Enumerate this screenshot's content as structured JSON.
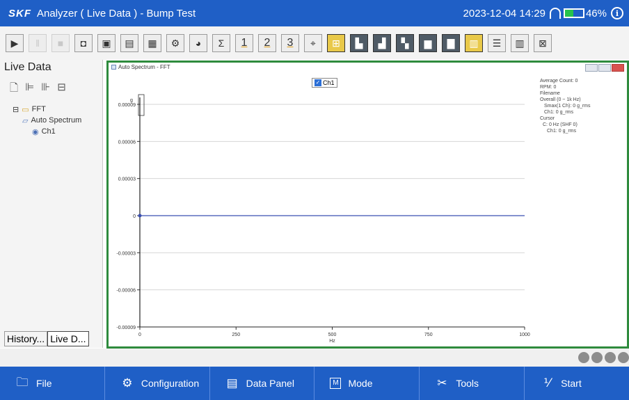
{
  "app": {
    "brand": "SKF",
    "title": "Analyzer ( Live Data ) - Bump Test",
    "datetime": "2023-12-04 14:29",
    "battery_text": "46%",
    "battery_level": 0.46,
    "colors": {
      "primary": "#1f5fc6",
      "accent_green": "#2e8b3d",
      "plot_line": "#3b4fb0"
    }
  },
  "toolbar": {
    "buttons": [
      {
        "icon": "play-icon",
        "glyph": "▶"
      },
      {
        "icon": "pause-icon",
        "glyph": "‖"
      },
      {
        "icon": "stop-icon",
        "glyph": "■"
      },
      {
        "icon": "camera-icon",
        "glyph": "◘"
      },
      {
        "icon": "image-icon",
        "glyph": "▣"
      },
      {
        "icon": "save-icon",
        "glyph": "▤"
      },
      {
        "icon": "report-icon",
        "glyph": "▦"
      },
      {
        "icon": "gear-icon",
        "glyph": "⚙"
      },
      {
        "icon": "pie-chart-icon",
        "glyph": "◕"
      },
      {
        "icon": "sum-icon",
        "glyph": "Σ"
      },
      {
        "icon": "view-1-icon",
        "glyph": "1"
      },
      {
        "icon": "view-2-icon",
        "glyph": "2"
      },
      {
        "icon": "view-3-icon",
        "glyph": "3"
      },
      {
        "icon": "cursor-icon",
        "glyph": "⌖"
      },
      {
        "icon": "add-icon",
        "glyph": "⊞"
      },
      {
        "icon": "spectrum-icon",
        "glyph": "▙"
      },
      {
        "icon": "spectrum-2-icon",
        "glyph": "▟"
      },
      {
        "icon": "waterfall-icon",
        "glyph": "▚"
      },
      {
        "icon": "bars-icon",
        "glyph": "▆"
      },
      {
        "icon": "histogram-icon",
        "glyph": "▇"
      },
      {
        "icon": "highlight-icon",
        "glyph": "▥"
      },
      {
        "icon": "rows-icon",
        "glyph": "☰"
      },
      {
        "icon": "columns-icon",
        "glyph": "▥"
      },
      {
        "icon": "close-window-icon",
        "glyph": "⊠"
      }
    ]
  },
  "left_panel": {
    "title": "Live Data",
    "tree": {
      "root": "FFT",
      "child": "Auto Spectrum",
      "leaf": "Ch1"
    },
    "tabs": [
      "History...",
      "Live D..."
    ]
  },
  "chart_window": {
    "title": "Auto Spectrum - FFT",
    "legend_label": "Ch1",
    "info": [
      "Average Count: 0",
      "RPM: 0",
      "Filename",
      "Overall (0 ~ 1k Hz)",
      "Smax(1 Ch): 0 g_rms",
      "Ch1: 0 g_rms",
      "Cursor",
      "C: 0 Hz (SHF 0)",
      "Ch1: 0 g_rms"
    ],
    "y_unit": "g"
  },
  "chart_data": {
    "type": "line",
    "title": "",
    "xlabel": "Hz",
    "ylabel": "g",
    "x_ticks": [
      "0",
      "250",
      "500",
      "750",
      "1000"
    ],
    "y_ticks": [
      "0.00009",
      "0.00006",
      "0.00003",
      "0",
      "-0.00003",
      "-0.00006",
      "-0.00009"
    ],
    "xlim": [
      0,
      1000
    ],
    "ylim": [
      -9e-05,
      9e-05
    ],
    "grid": true,
    "series": [
      {
        "name": "Ch1",
        "x": [
          0,
          1000
        ],
        "values": [
          0,
          0
        ]
      }
    ]
  },
  "bottom_nav": [
    {
      "icon": "folder-icon",
      "glyph": "🗀",
      "label": "File"
    },
    {
      "icon": "configuration-icon",
      "glyph": "⚙",
      "label": "Configuration"
    },
    {
      "icon": "data-panel-icon",
      "glyph": "▤",
      "label": "Data Panel"
    },
    {
      "icon": "mode-icon",
      "glyph": "M",
      "label": "Mode"
    },
    {
      "icon": "tools-icon",
      "glyph": "✂",
      "label": "Tools"
    },
    {
      "icon": "start-icon",
      "glyph": "⅟",
      "label": "Start"
    }
  ]
}
